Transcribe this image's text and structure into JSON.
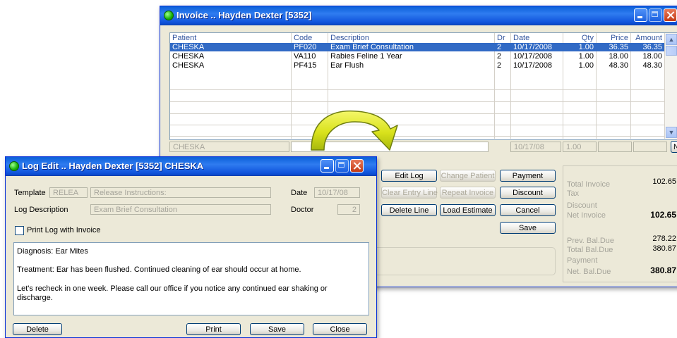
{
  "invoice_window": {
    "title": "Invoice .. Hayden Dexter  [5352]",
    "columns": [
      "Patient",
      "Code",
      "Description",
      "Dr",
      "Date",
      "Qty",
      "Price",
      "Amount"
    ],
    "rows": [
      {
        "patient": "CHESKA",
        "code": "PF020",
        "description": "Exam Brief Consultation",
        "dr": "2",
        "date": "10/17/2008",
        "qty": "1.00",
        "price": "36.35",
        "amount": "36.35"
      },
      {
        "patient": "CHESKA",
        "code": "VA110",
        "description": "Rabies Feline 1 Year",
        "dr": "2",
        "date": "10/17/2008",
        "qty": "1.00",
        "price": "18.00",
        "amount": "18.00"
      },
      {
        "patient": "CHESKA",
        "code": "PF415",
        "description": "Ear Flush",
        "dr": "2",
        "date": "10/17/2008",
        "qty": "1.00",
        "price": "48.30",
        "amount": "48.30"
      }
    ],
    "entry_row": {
      "patient": "CHESKA",
      "date": "10/17/08",
      "qty": "1.00",
      "new_label": "N"
    },
    "buttons": {
      "edit_log": "Edit Log",
      "change_patient": "Change Patient",
      "payment": "Payment",
      "clear_entry_line": "Clear Entry Line",
      "repeat_invoice": "Repeat Invoice",
      "discount": "Discount",
      "delete_line": "Delete Line",
      "load_estimate": "Load Estimate",
      "cancel": "Cancel",
      "save": "Save"
    },
    "summary": {
      "total_invoice_label": "Total Invoice",
      "total_invoice": "102.65",
      "tax_label": "Tax",
      "discount_label": "Discount",
      "net_invoice_label": "Net Invoice",
      "net_invoice": "102.65",
      "prev_bal_label": "Prev. Bal.Due",
      "prev_bal": "278.22",
      "total_bal_label": "Total Bal.Due",
      "total_bal": "380.87",
      "payment_label": "Payment",
      "net_bal_label": "Net. Bal.Due",
      "net_bal": "380.87"
    }
  },
  "log_window": {
    "title": "Log Edit .. Hayden Dexter  [5352]  CHESKA",
    "template_label": "Template",
    "template_code": "RELEA",
    "template_name": "Release Instructions:",
    "date_label": "Date",
    "date_value": "10/17/08",
    "log_description_label": "Log Description",
    "log_description_value": "Exam Brief Consultation",
    "doctor_label": "Doctor",
    "doctor_value": "2",
    "print_log_label": "Print Log with Invoice",
    "memo_lines": [
      "Diagnosis:  Ear Mites",
      "Treatment:  Ear has been flushed.  Continued cleaning of ear should occur at home.",
      "Let's recheck in one week.  Please call our office if you notice any continued ear shaking or",
      "discharge."
    ],
    "buttons": {
      "delete": "Delete",
      "print": "Print",
      "save": "Save",
      "close": "Close"
    }
  },
  "colors": {
    "titlebar": "#0a5fd8",
    "selection": "#316ac5",
    "arrow": "#d9e21c",
    "window_face": "#ece9d8"
  }
}
